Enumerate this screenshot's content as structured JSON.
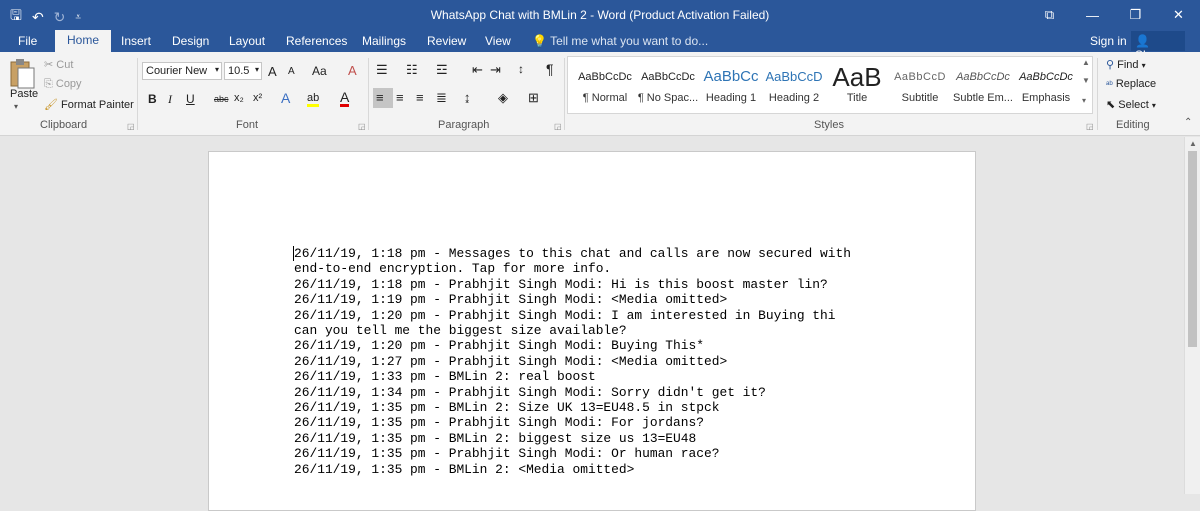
{
  "window": {
    "title": "WhatsApp Chat with BMLin 2 - Word (Product Activation Failed)",
    "controls": [
      "⧉",
      "—",
      "❐",
      "✕"
    ]
  },
  "quick_access": {
    "save": "🖫",
    "undo": "↶",
    "redo": "↻",
    "customize": "⩡"
  },
  "tabs": [
    "File",
    "Home",
    "Insert",
    "Design",
    "Layout",
    "References",
    "Mailings",
    "Review",
    "View"
  ],
  "active_tab": "Home",
  "tell_me": "Tell me what you want to do...",
  "account": {
    "signin": "Sign in",
    "share": "Share"
  },
  "ribbon": {
    "clipboard": {
      "label": "Clipboard",
      "paste": "Paste",
      "cut": "Cut",
      "copy": "Copy",
      "format_painter": "Format Painter"
    },
    "font": {
      "label": "Font",
      "family": "Courier New",
      "size": "10.5",
      "grow": "A",
      "shrink": "A",
      "change_case": "Aa",
      "clear": "A",
      "bold": "B",
      "italic": "I",
      "underline": "U",
      "strike": "abc",
      "subscript": "x₂",
      "superscript": "x²",
      "text_effects": "A",
      "highlight": "ab",
      "font_color": "A"
    },
    "paragraph": {
      "label": "Paragraph",
      "pilcrow": "¶"
    },
    "styles": {
      "label": "Styles",
      "items": [
        {
          "preview": "AaBbCcDc",
          "name": "¶ Normal"
        },
        {
          "preview": "AaBbCcDc",
          "name": "¶ No Spac..."
        },
        {
          "preview": "AaBbCc",
          "name": "Heading 1"
        },
        {
          "preview": "AaBbCcD",
          "name": "Heading 2"
        },
        {
          "preview": "AaB",
          "name": "Title"
        },
        {
          "preview": "AaBbCcD",
          "name": "Subtitle"
        },
        {
          "preview": "AaBbCcDc",
          "name": "Subtle Em..."
        },
        {
          "preview": "AaBbCcDc",
          "name": "Emphasis"
        }
      ]
    },
    "editing": {
      "label": "Editing",
      "find": "Find",
      "replace": "Replace",
      "select": "Select"
    }
  },
  "document": {
    "lines": [
      "26/11/19, 1:18 pm - Messages to this chat and calls are now secured with",
      "end-to-end encryption. Tap for more info.",
      "26/11/19, 1:18 pm - Prabhjit Singh Modi: Hi is this boost master lin?",
      "26/11/19, 1:19 pm - Prabhjit Singh Modi: <Media omitted>",
      "26/11/19, 1:20 pm - Prabhjit Singh Modi: I am interested in Buying thi",
      "can you tell me the biggest size available?",
      "26/11/19, 1:20 pm - Prabhjit Singh Modi: Buying This*",
      "26/11/19, 1:27 pm - Prabhjit Singh Modi: <Media omitted>",
      "26/11/19, 1:33 pm - BMLin 2: real boost",
      "26/11/19, 1:34 pm - Prabhjit Singh Modi: Sorry didn't get it?",
      "26/11/19, 1:35 pm - BMLin 2: Size UK 13=EU48.5 in stpck",
      "26/11/19, 1:35 pm - Prabhjit Singh Modi: For jordans?",
      "26/11/19, 1:35 pm - BMLin 2: biggest size us 13=EU48",
      "26/11/19, 1:35 pm - Prabhjit Singh Modi: Or human race?",
      "26/11/19, 1:35 pm - BMLin 2: <Media omitted>"
    ]
  },
  "colors": {
    "brand": "#2b579a",
    "ribbon_bg": "#f3f3f3",
    "canvas_bg": "#e6e6e6"
  }
}
